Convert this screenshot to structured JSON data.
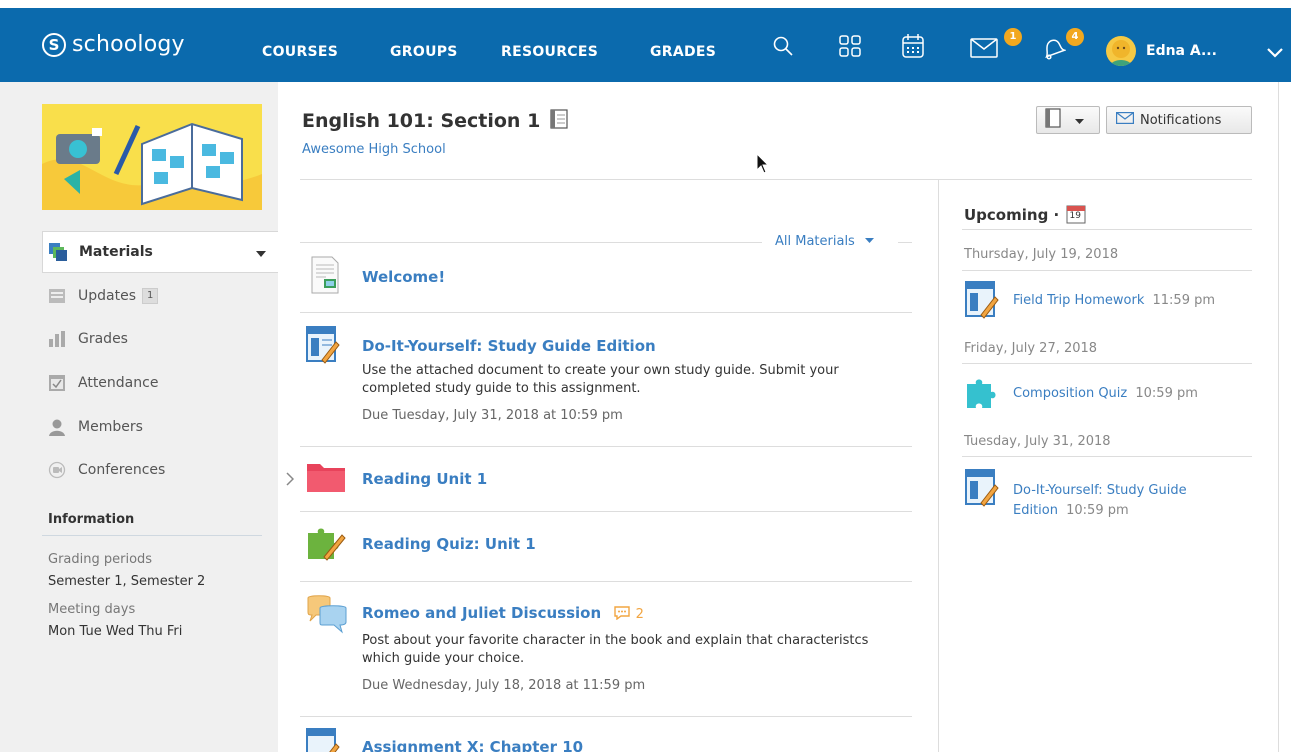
{
  "brand": {
    "logo_text": "schoology",
    "logo_letter": "S",
    "color": "#0b6aad"
  },
  "topnav": {
    "items": [
      "COURSES",
      "GROUPS",
      "RESOURCES",
      "GRADES"
    ],
    "mail_badge": "1",
    "notif_badge": "4",
    "user_name": "Edna A..."
  },
  "sidebar": {
    "items": [
      {
        "label": "Materials",
        "icon": "materials-icon"
      },
      {
        "label": "Updates",
        "icon": "updates-icon",
        "badge": "1"
      },
      {
        "label": "Grades",
        "icon": "grades-icon"
      },
      {
        "label": "Attendance",
        "icon": "attendance-icon"
      },
      {
        "label": "Members",
        "icon": "members-icon"
      },
      {
        "label": "Conferences",
        "icon": "conferences-icon"
      }
    ],
    "info_title": "Information",
    "grading_label": "Grading periods",
    "grading_value": "Semester 1, Semester 2",
    "meeting_label": "Meeting days",
    "meeting_value": "Mon Tue Wed Thu Fri"
  },
  "course": {
    "title": "English 101: Section 1",
    "school": "Awesome High School",
    "notifications_label": "Notifications"
  },
  "materials": {
    "filter_label": "All Materials",
    "items": [
      {
        "title": "Welcome!",
        "type": "page"
      },
      {
        "title": "Do-It-Yourself: Study Guide Edition",
        "type": "assignment",
        "desc": "Use the attached document to create your own study guide. Submit your completed study guide to this assignment.",
        "due": "Due Tuesday, July 31, 2018 at 10:59 pm"
      },
      {
        "title": "Reading Unit 1",
        "type": "folder"
      },
      {
        "title": "Reading Quiz: Unit 1",
        "type": "quiz"
      },
      {
        "title": "Romeo and Juliet Discussion",
        "type": "discussion",
        "comments": "2",
        "desc": "Post about your favorite character in the book and explain that characteristcs which guide your choice.",
        "due": "Due Wednesday, July 18, 2018 at 11:59 pm"
      },
      {
        "title": "Assignment X: Chapter 10",
        "type": "assignment"
      }
    ]
  },
  "upcoming": {
    "title": "Upcoming ·",
    "calendar_day": "19",
    "groups": [
      {
        "date": "Thursday, July 19, 2018",
        "link": "Field Trip Homework",
        "time": "11:59 pm"
      },
      {
        "date": "Friday, July 27, 2018",
        "link": "Composition Quiz",
        "time": "10:59 pm"
      },
      {
        "date": "Tuesday, July 31, 2018",
        "link": "Do-It-Yourself: Study Guide Edition",
        "time": "10:59 pm"
      }
    ]
  }
}
